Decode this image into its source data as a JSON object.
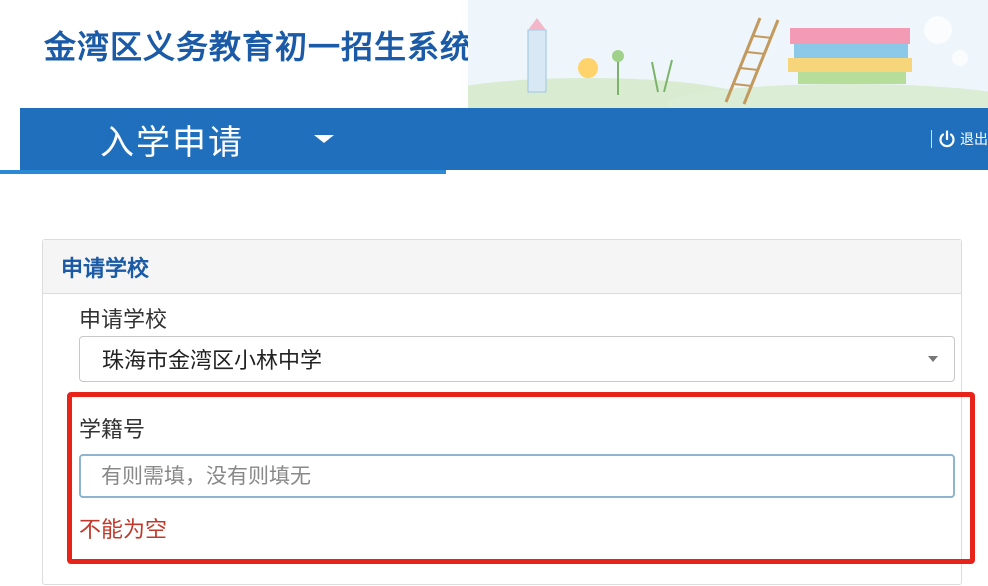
{
  "header": {
    "system_title": "金湾区义务教育初一招生系统"
  },
  "navbar": {
    "dropdown_label": "入学申请",
    "logout_label": "退出"
  },
  "panel": {
    "heading": "申请学校",
    "school_label": "申请学校",
    "school_selected": "珠海市金湾区小林中学",
    "student_id_label": "学籍号",
    "student_id_placeholder": "有则需填，没有则填无",
    "student_id_value": "",
    "error_message": "不能为空"
  },
  "icons": {
    "logout": "power-icon",
    "dropdown": "caret-down-icon",
    "select": "chevron-down-icon"
  },
  "colors": {
    "brand_blue": "#1f6fbd",
    "title_blue": "#1a5aa6",
    "error_red": "#c0392b",
    "highlight_red": "#e8231a"
  }
}
